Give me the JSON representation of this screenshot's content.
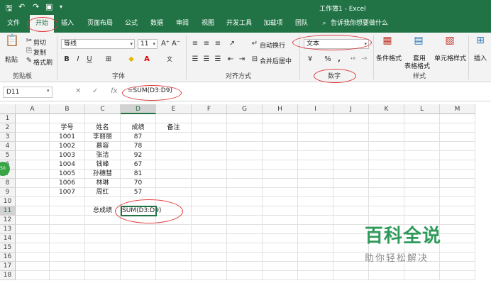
{
  "window": {
    "title": "工作簿1 - Excel"
  },
  "tabs": [
    "文件",
    "开始",
    "插入",
    "页面布局",
    "公式",
    "数据",
    "审阅",
    "视图",
    "开发工具",
    "加载项",
    "团队"
  ],
  "active_tab": "开始",
  "search_hint": "告诉我你想要做什么",
  "ribbon": {
    "clipboard": {
      "label": "剪贴板",
      "paste": "粘贴",
      "cut": "剪切",
      "copy": "复制",
      "format_painter": "格式刷"
    },
    "font": {
      "label": "字体",
      "font_name": "等线",
      "font_size": "11",
      "grow": "A⁺",
      "shrink": "A⁻",
      "bold": "B",
      "italic": "I",
      "underline": "U"
    },
    "alignment": {
      "label": "对齐方式",
      "wrap": "自动换行",
      "merge": "合并后居中"
    },
    "number": {
      "label": "数字",
      "format": "文本",
      "percent": "%",
      "comma": ","
    },
    "styles": {
      "label": "样式",
      "conditional": "条件格式",
      "table_line1": "套用",
      "table_line2": "表格格式",
      "cell_styles": "单元格样式"
    },
    "cells": {
      "insert": "插入"
    }
  },
  "formula_bar": {
    "name_box": "D11",
    "fx": "fx",
    "formula": "=SUM(D3:D9)"
  },
  "columns": [
    "A",
    "B",
    "C",
    "D",
    "E",
    "F",
    "G",
    "H",
    "I",
    "J",
    "K",
    "L",
    "M"
  ],
  "rows": [
    "1",
    "2",
    "3",
    "4",
    "5",
    "6",
    "7",
    "8",
    "9",
    "10",
    "11",
    "12",
    "13",
    "14",
    "15",
    "16",
    "17",
    "18"
  ],
  "sheet": {
    "headers": {
      "id": "学号",
      "name": "姓名",
      "score": "成绩",
      "note": "备注"
    },
    "records": [
      {
        "id": "1001",
        "name": "李丽丽",
        "score": "87"
      },
      {
        "id": "1002",
        "name": "慕容",
        "score": "78"
      },
      {
        "id": "1003",
        "name": "张洁",
        "score": "92"
      },
      {
        "id": "1004",
        "name": "钱峰",
        "score": "67"
      },
      {
        "id": "1005",
        "name": "孙穗彗",
        "score": "81"
      },
      {
        "id": "1006",
        "name": "林琳",
        "score": "70"
      },
      {
        "id": "1007",
        "name": "周红",
        "score": "57"
      }
    ],
    "total_label": "总成绩",
    "total_formula": "SUM(D3:D9)"
  },
  "watermark": {
    "brand": "百科全说",
    "slogan": "助你轻松解决"
  },
  "left_badge": "50",
  "colors": {
    "excel_green": "#217346",
    "annotation_red": "#e0393a",
    "watermark_green": "#2e9a5a"
  }
}
